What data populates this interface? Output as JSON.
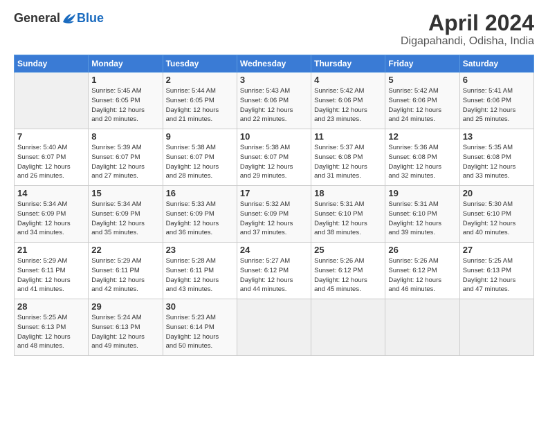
{
  "logo": {
    "general": "General",
    "blue": "Blue"
  },
  "header": {
    "title": "April 2024",
    "location": "Digapahandi, Odisha, India"
  },
  "days_of_week": [
    "Sunday",
    "Monday",
    "Tuesday",
    "Wednesday",
    "Thursday",
    "Friday",
    "Saturday"
  ],
  "weeks": [
    [
      {
        "num": "",
        "data": ""
      },
      {
        "num": "1",
        "data": "Sunrise: 5:45 AM\nSunset: 6:05 PM\nDaylight: 12 hours\nand 20 minutes."
      },
      {
        "num": "2",
        "data": "Sunrise: 5:44 AM\nSunset: 6:05 PM\nDaylight: 12 hours\nand 21 minutes."
      },
      {
        "num": "3",
        "data": "Sunrise: 5:43 AM\nSunset: 6:06 PM\nDaylight: 12 hours\nand 22 minutes."
      },
      {
        "num": "4",
        "data": "Sunrise: 5:42 AM\nSunset: 6:06 PM\nDaylight: 12 hours\nand 23 minutes."
      },
      {
        "num": "5",
        "data": "Sunrise: 5:42 AM\nSunset: 6:06 PM\nDaylight: 12 hours\nand 24 minutes."
      },
      {
        "num": "6",
        "data": "Sunrise: 5:41 AM\nSunset: 6:06 PM\nDaylight: 12 hours\nand 25 minutes."
      }
    ],
    [
      {
        "num": "7",
        "data": "Sunrise: 5:40 AM\nSunset: 6:07 PM\nDaylight: 12 hours\nand 26 minutes."
      },
      {
        "num": "8",
        "data": "Sunrise: 5:39 AM\nSunset: 6:07 PM\nDaylight: 12 hours\nand 27 minutes."
      },
      {
        "num": "9",
        "data": "Sunrise: 5:38 AM\nSunset: 6:07 PM\nDaylight: 12 hours\nand 28 minutes."
      },
      {
        "num": "10",
        "data": "Sunrise: 5:38 AM\nSunset: 6:07 PM\nDaylight: 12 hours\nand 29 minutes."
      },
      {
        "num": "11",
        "data": "Sunrise: 5:37 AM\nSunset: 6:08 PM\nDaylight: 12 hours\nand 31 minutes."
      },
      {
        "num": "12",
        "data": "Sunrise: 5:36 AM\nSunset: 6:08 PM\nDaylight: 12 hours\nand 32 minutes."
      },
      {
        "num": "13",
        "data": "Sunrise: 5:35 AM\nSunset: 6:08 PM\nDaylight: 12 hours\nand 33 minutes."
      }
    ],
    [
      {
        "num": "14",
        "data": "Sunrise: 5:34 AM\nSunset: 6:09 PM\nDaylight: 12 hours\nand 34 minutes."
      },
      {
        "num": "15",
        "data": "Sunrise: 5:34 AM\nSunset: 6:09 PM\nDaylight: 12 hours\nand 35 minutes."
      },
      {
        "num": "16",
        "data": "Sunrise: 5:33 AM\nSunset: 6:09 PM\nDaylight: 12 hours\nand 36 minutes."
      },
      {
        "num": "17",
        "data": "Sunrise: 5:32 AM\nSunset: 6:09 PM\nDaylight: 12 hours\nand 37 minutes."
      },
      {
        "num": "18",
        "data": "Sunrise: 5:31 AM\nSunset: 6:10 PM\nDaylight: 12 hours\nand 38 minutes."
      },
      {
        "num": "19",
        "data": "Sunrise: 5:31 AM\nSunset: 6:10 PM\nDaylight: 12 hours\nand 39 minutes."
      },
      {
        "num": "20",
        "data": "Sunrise: 5:30 AM\nSunset: 6:10 PM\nDaylight: 12 hours\nand 40 minutes."
      }
    ],
    [
      {
        "num": "21",
        "data": "Sunrise: 5:29 AM\nSunset: 6:11 PM\nDaylight: 12 hours\nand 41 minutes."
      },
      {
        "num": "22",
        "data": "Sunrise: 5:29 AM\nSunset: 6:11 PM\nDaylight: 12 hours\nand 42 minutes."
      },
      {
        "num": "23",
        "data": "Sunrise: 5:28 AM\nSunset: 6:11 PM\nDaylight: 12 hours\nand 43 minutes."
      },
      {
        "num": "24",
        "data": "Sunrise: 5:27 AM\nSunset: 6:12 PM\nDaylight: 12 hours\nand 44 minutes."
      },
      {
        "num": "25",
        "data": "Sunrise: 5:26 AM\nSunset: 6:12 PM\nDaylight: 12 hours\nand 45 minutes."
      },
      {
        "num": "26",
        "data": "Sunrise: 5:26 AM\nSunset: 6:12 PM\nDaylight: 12 hours\nand 46 minutes."
      },
      {
        "num": "27",
        "data": "Sunrise: 5:25 AM\nSunset: 6:13 PM\nDaylight: 12 hours\nand 47 minutes."
      }
    ],
    [
      {
        "num": "28",
        "data": "Sunrise: 5:25 AM\nSunset: 6:13 PM\nDaylight: 12 hours\nand 48 minutes."
      },
      {
        "num": "29",
        "data": "Sunrise: 5:24 AM\nSunset: 6:13 PM\nDaylight: 12 hours\nand 49 minutes."
      },
      {
        "num": "30",
        "data": "Sunrise: 5:23 AM\nSunset: 6:14 PM\nDaylight: 12 hours\nand 50 minutes."
      },
      {
        "num": "",
        "data": ""
      },
      {
        "num": "",
        "data": ""
      },
      {
        "num": "",
        "data": ""
      },
      {
        "num": "",
        "data": ""
      }
    ]
  ]
}
